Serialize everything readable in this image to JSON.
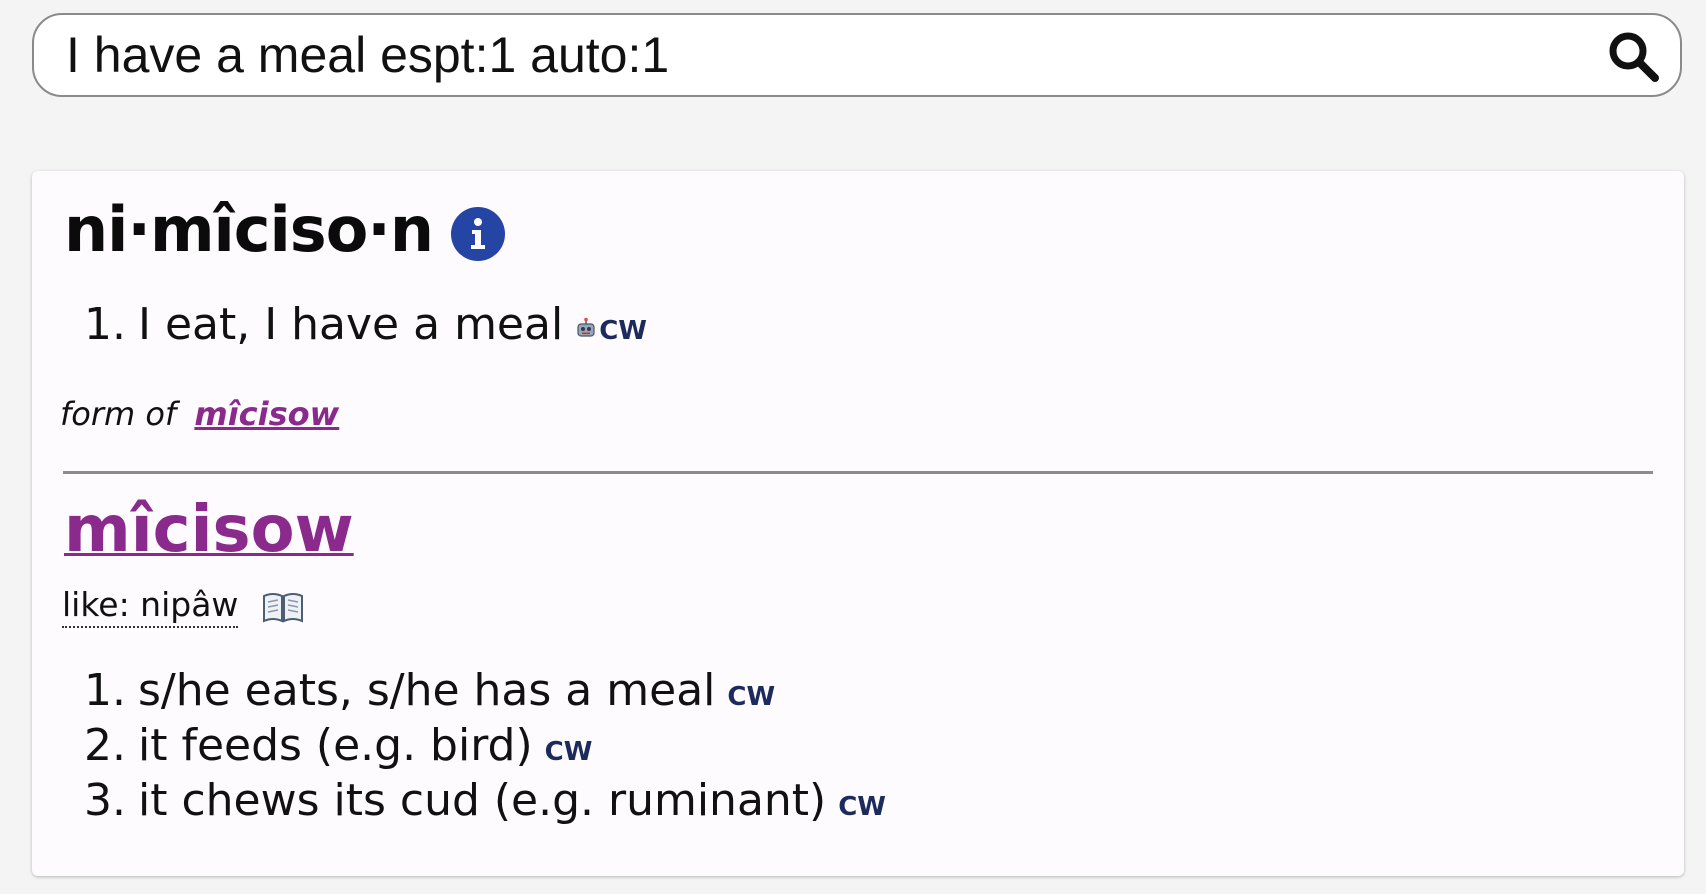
{
  "search": {
    "query": "I have a meal espt:1 auto:1",
    "icon": "search-icon"
  },
  "entry": {
    "headword": "ni·mîciso·n",
    "info_icon": "info-icon",
    "definitions": [
      {
        "num": "1.",
        "text": "I eat, I have a meal",
        "source": "CW",
        "auto_icon": "robot-icon"
      }
    ],
    "form_of_label": "form of",
    "form_of_link": "mîcisow"
  },
  "lemma": {
    "title": "mîcisow",
    "paradigm_label": "like: nipâw",
    "paradigm_icon": "book-icon",
    "definitions": [
      {
        "num": "1.",
        "text": "s/he eats, s/he has a meal",
        "source": "CW"
      },
      {
        "num": "2.",
        "text": "it feeds (e.g. bird)",
        "source": "CW"
      },
      {
        "num": "3.",
        "text": "it chews its cud (e.g. ruminant)",
        "source": "CW"
      }
    ]
  },
  "colors": {
    "link": "#8a2a8c",
    "info_badge": "#2545a4",
    "source_tag": "#1c2a5c"
  }
}
